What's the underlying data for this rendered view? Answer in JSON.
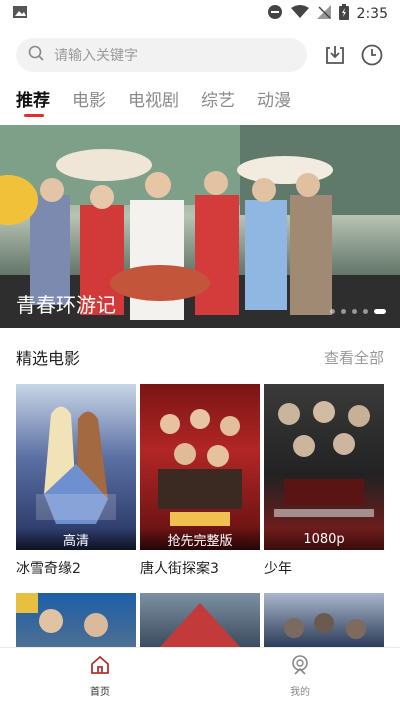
{
  "statusbar": {
    "time": "2:35"
  },
  "search": {
    "placeholder": "请输入关键字"
  },
  "tabs": [
    {
      "label": "推荐"
    },
    {
      "label": "电影"
    },
    {
      "label": "电视剧"
    },
    {
      "label": "综艺"
    },
    {
      "label": "动漫"
    }
  ],
  "banner": {
    "caption": "青春环游记",
    "active_slide": 5,
    "slide_count": 5
  },
  "section": {
    "title": "精选电影",
    "link": "查看全部"
  },
  "movies": [
    {
      "title": "冰雪奇缘2",
      "badge": "高清"
    },
    {
      "title": "唐人街探案3",
      "badge": "抢先完整版"
    },
    {
      "title": "少年",
      "badge": "1080p"
    }
  ],
  "nav": {
    "home": "首页",
    "mine": "我的"
  },
  "colors": {
    "accent": "#e03030",
    "nav_active": "#b83232",
    "muted": "#999999"
  }
}
